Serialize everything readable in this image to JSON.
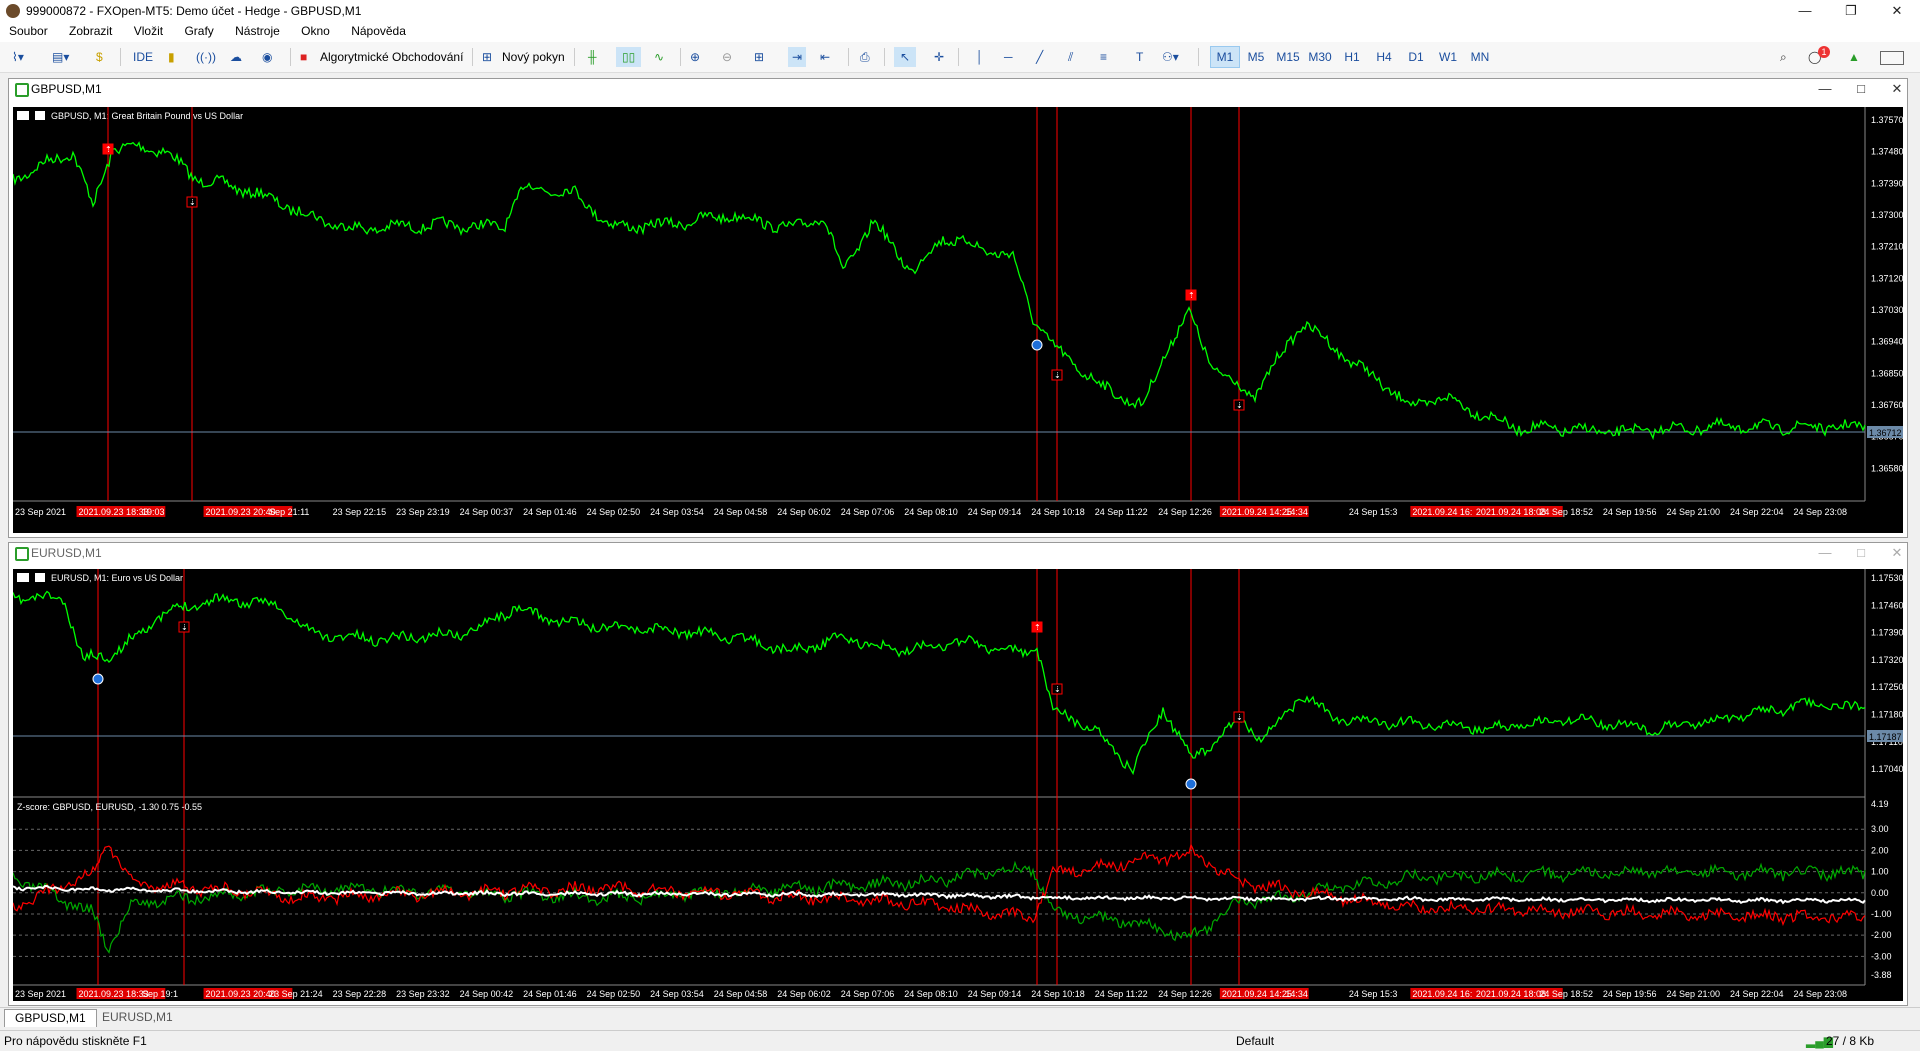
{
  "window": {
    "title": "999000872 - FXOpen-MT5: Demo účet - Hedge - GBPUSD,M1"
  },
  "menu": [
    "Soubor",
    "Zobrazit",
    "Vložit",
    "Grafy",
    "Nástroje",
    "Okno",
    "Nápověda"
  ],
  "toolbar": {
    "ide_label": "IDE",
    "algo_label": "Algorytmické Obchodování",
    "new_order_label": "Nový pokyn",
    "timeframes": [
      "M1",
      "M5",
      "M15",
      "M30",
      "H1",
      "H4",
      "D1",
      "W1",
      "MN"
    ],
    "active_timeframe": "M1",
    "notification_count": "1"
  },
  "charts": [
    {
      "window_title": "GBPUSD,M1",
      "symbol_label": "GBPUSD, M1:  Great Britain Pound vs US Dollar",
      "price_ticks": [
        "1.37570",
        "1.37480",
        "1.37390",
        "1.37300",
        "1.37210",
        "1.37120",
        "1.37030",
        "1.36940",
        "1.36850",
        "1.36760",
        "1.36670",
        "1.36580"
      ],
      "current_price": "1.36712",
      "time_labels": [
        "23 Sep 2021",
        "2021.09.23 18:33",
        "19:03",
        "2021.09.23 20:40",
        "Sep 21:11",
        "23 Sep 22:15",
        "23 Sep 23:19",
        "24 Sep 00:37",
        "24 Sep 01:46",
        "24 Sep 02:50",
        "24 Sep 03:54",
        "24 Sep 04:58",
        "24 Sep 06:02",
        "24 Sep 07:06",
        "24 Sep 08:10",
        "24 Sep 09:14",
        "24 Sep 10:18",
        "24 Sep 11:22",
        "24 Sep 12:26",
        "2021.09.24 14:25",
        "14:34",
        "24 Sep 15:3",
        "2021.09.24 16:",
        "2021.09.24 18:08",
        "24 Sep 18:52",
        "24 Sep 19:56",
        "24 Sep 21:00",
        "24 Sep 22:04",
        "24 Sep 23:08"
      ]
    },
    {
      "window_title": "EURUSD,M1",
      "symbol_label": "EURUSD, M1:  Euro vs US Dollar",
      "price_ticks": [
        "1.17530",
        "1.17460",
        "1.17390",
        "1.17320",
        "1.17250",
        "1.17180",
        "1.17110",
        "1.17040"
      ],
      "current_price": "1.17187",
      "indicator_label": "Z-score: GBPUSD, EURUSD,  -1.30 0.75 -0.55",
      "indicator_ticks": [
        "4.19",
        "3.00",
        "2.00",
        "1.00",
        "0.00",
        "-1.00",
        "-2.00",
        "-3.00",
        "-3.88"
      ],
      "time_labels": [
        "23 Sep 2021",
        "2021.09.23 18:33",
        "Sep 19:1",
        "2021.09.23 20:40",
        "23 Sep 21:24",
        "23 Sep 22:28",
        "23 Sep 23:32",
        "24 Sep 00:42",
        "24 Sep 01:46",
        "24 Sep 02:50",
        "24 Sep 03:54",
        "24 Sep 04:58",
        "24 Sep 06:02",
        "24 Sep 07:06",
        "24 Sep 08:10",
        "24 Sep 09:14",
        "24 Sep 10:18",
        "24 Sep 11:22",
        "24 Sep 12:26",
        "2021.09.24 14:25",
        "14:34",
        "24 Sep 15:3",
        "2021.09.24 16:",
        "2021.09.24 18:08",
        "24 Sep 18:52",
        "24 Sep 19:56",
        "24 Sep 21:00",
        "24 Sep 22:04",
        "24 Sep 23:08"
      ]
    }
  ],
  "tabs": [
    "GBPUSD,M1",
    "EURUSD,M1"
  ],
  "status": {
    "help": "Pro nápovědu stiskněte F1",
    "profile": "Default",
    "traffic": "27 / 8 Kb"
  },
  "colors": {
    "price_line": "#00ff00",
    "marker": "#ff0000",
    "background": "#000000",
    "zscore_a": "#00aa00",
    "zscore_b": "#ff0000",
    "zscore_c": "#ffffff"
  }
}
